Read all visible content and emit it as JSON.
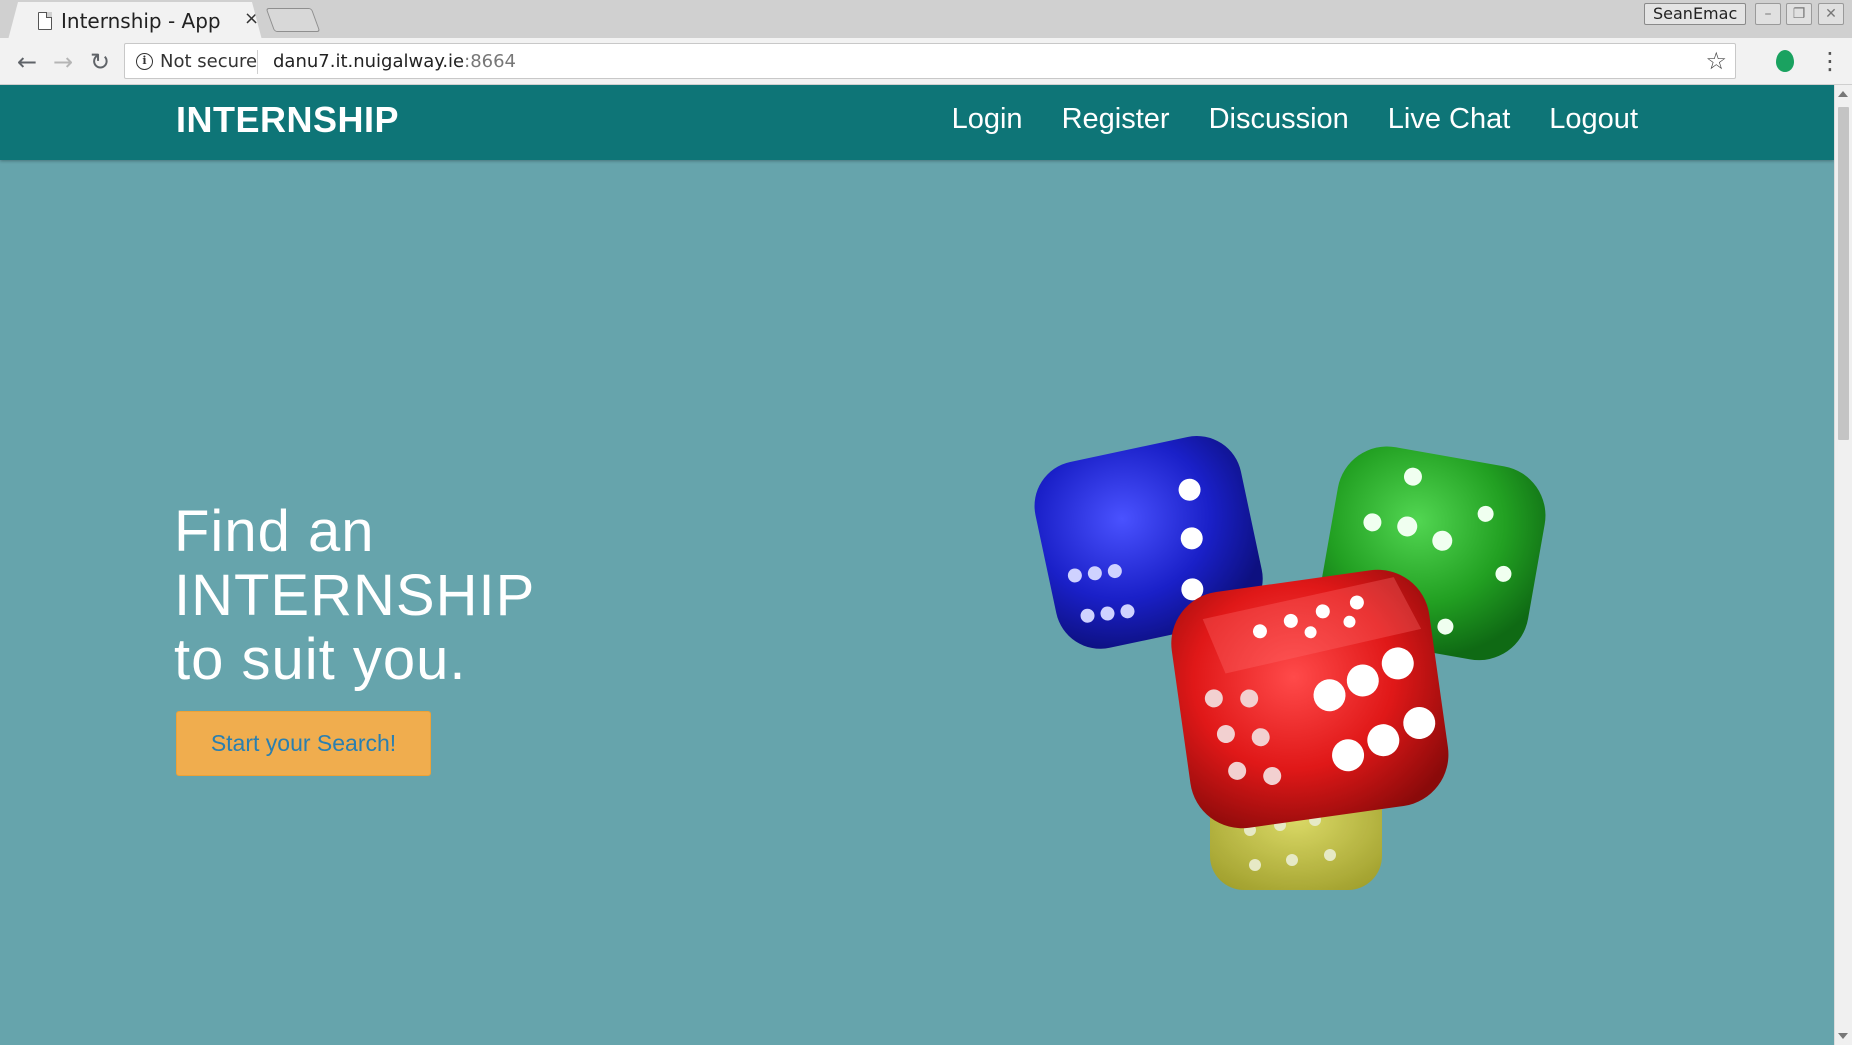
{
  "browser": {
    "tab_title": "Internship - App",
    "tab_close": "×",
    "profile_name": "SeanEmac",
    "security_label": "Not secure",
    "url_host": "danu7.it.nuigalway.ie",
    "url_port": ":8664",
    "icons": {
      "back": "back-arrow-icon",
      "forward": "forward-arrow-icon",
      "reload": "reload-icon",
      "info": "info-icon",
      "bookmark": "star-icon",
      "extension": "extension-icon",
      "menu": "kebab-menu-icon"
    }
  },
  "navbar": {
    "brand": "INTERNSHIP",
    "links": [
      "Login",
      "Register",
      "Discussion",
      "Live Chat",
      "Logout"
    ],
    "background": "#0e7577"
  },
  "hero": {
    "heading_lines": [
      "Find an",
      "INTERNSHIP",
      "to suit you."
    ],
    "cta_label": "Start your Search!",
    "background": "#66a4ac",
    "cta_color": "#f0ad4e",
    "image": "dice-image"
  }
}
